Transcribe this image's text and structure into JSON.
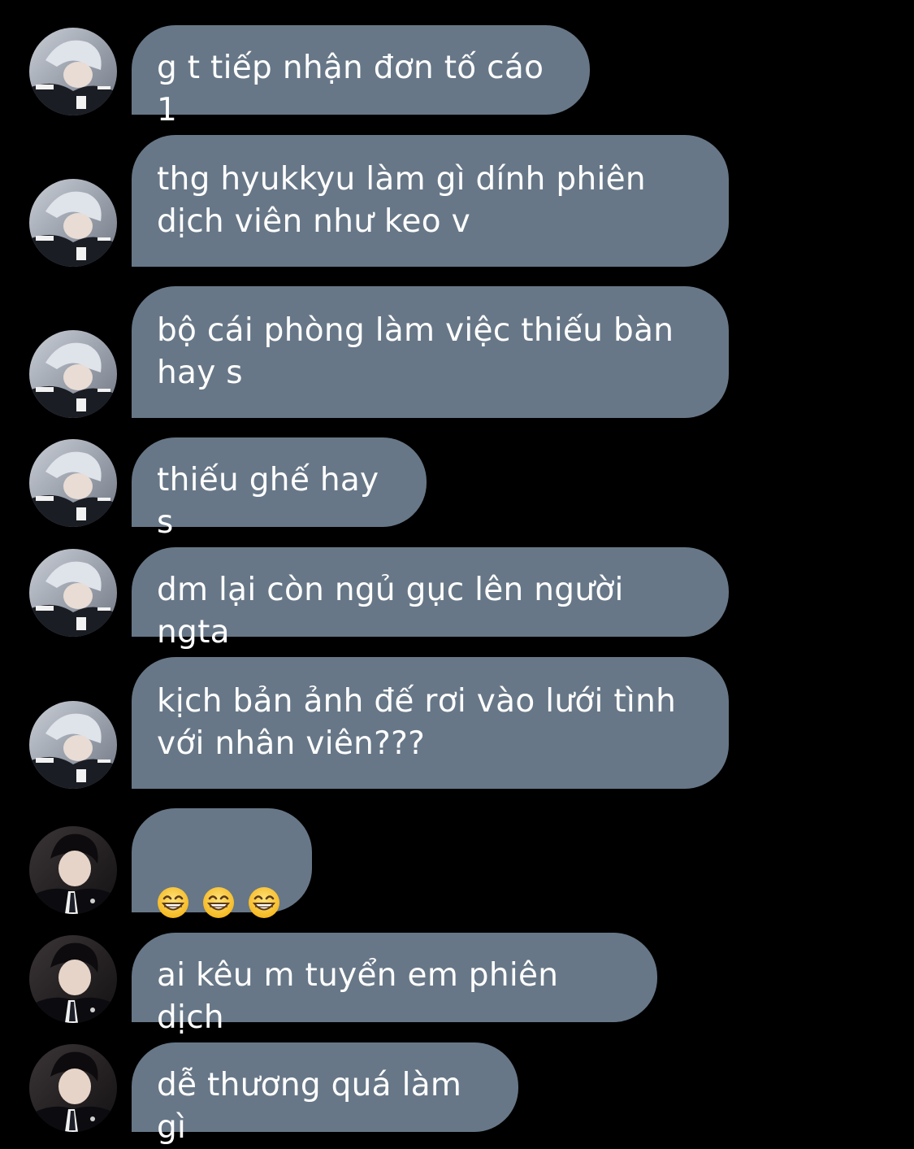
{
  "chat": {
    "messages": [
      {
        "sender": "user_a",
        "text": "g t tiếp nhận đơn tố cáo 1"
      },
      {
        "sender": "user_a",
        "text": "thg hyukkyu làm gì dính phiên\ndịch viên như keo v"
      },
      {
        "sender": "user_a",
        "text": "bộ cái phòng làm việc thiếu bàn\nhay s"
      },
      {
        "sender": "user_a",
        "text": "thiếu ghế hay s"
      },
      {
        "sender": "user_a",
        "text": "dm lại còn ngủ gục lên người ngta"
      },
      {
        "sender": "user_a",
        "text": "kịch bản ảnh đế rơi vào lưới tình\nvới nhân viên???"
      },
      {
        "sender": "user_b",
        "emojis": [
          "grinning-face-with-smiling-eyes",
          "grinning-face-with-smiling-eyes",
          "grinning-face-with-smiling-eyes"
        ]
      },
      {
        "sender": "user_b",
        "text": "ai kêu m tuyển em phiên dịch"
      },
      {
        "sender": "user_b",
        "text": "dễ thương quá làm gì"
      }
    ]
  },
  "colors": {
    "background": "#000000",
    "bubble": "#677787",
    "bubble_text": "#ffffff"
  }
}
